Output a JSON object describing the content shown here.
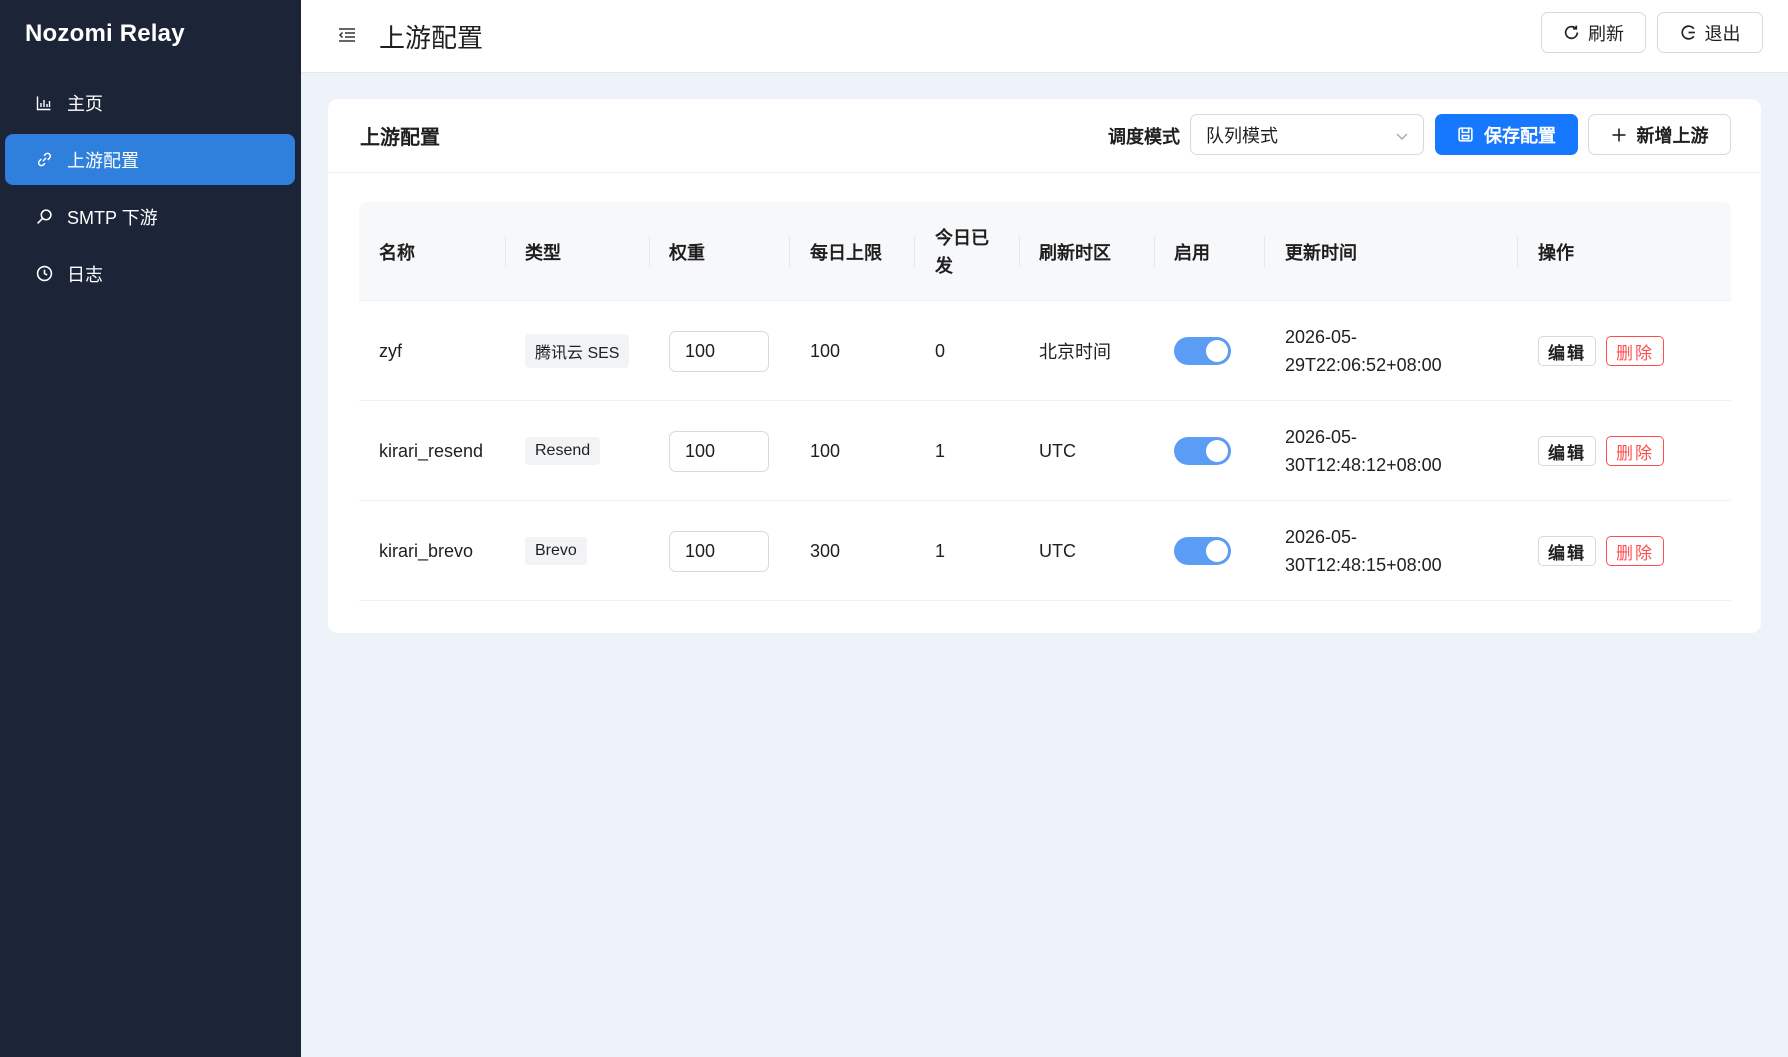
{
  "brand": "Nozomi Relay",
  "sidebar": {
    "items": [
      {
        "label": "主页",
        "icon": "bar-chart-icon",
        "active": false
      },
      {
        "label": "上游配置",
        "icon": "link-icon",
        "active": true
      },
      {
        "label": "SMTP 下游",
        "icon": "search-icon",
        "active": false
      },
      {
        "label": "日志",
        "icon": "clock-icon",
        "active": false
      }
    ]
  },
  "header": {
    "title": "上游配置",
    "refresh_label": "刷新",
    "logout_label": "退出"
  },
  "card": {
    "title": "上游配置",
    "mode_label": "调度模式",
    "mode_value": "队列模式",
    "save_label": "保存配置",
    "add_label": "新增上游"
  },
  "table": {
    "columns": [
      "名称",
      "类型",
      "权重",
      "每日上限",
      "今日已发",
      "刷新时区",
      "启用",
      "更新时间",
      "操作"
    ],
    "rows": [
      {
        "name": "zyf",
        "type": "腾讯云 SES",
        "weight": "100",
        "daily_limit": "100",
        "sent_today": "0",
        "timezone": "北京时间",
        "enabled": true,
        "updated_line1": "2026-05-",
        "updated_line2": "29T22:06:52+08:00"
      },
      {
        "name": "kirari_resend",
        "type": "Resend",
        "weight": "100",
        "daily_limit": "100",
        "sent_today": "1",
        "timezone": "UTC",
        "enabled": true,
        "updated_line1": "2026-05-",
        "updated_line2": "30T12:48:12+08:00"
      },
      {
        "name": "kirari_brevo",
        "type": "Brevo",
        "weight": "100",
        "daily_limit": "300",
        "sent_today": "1",
        "timezone": "UTC",
        "enabled": true,
        "updated_line1": "2026-05-",
        "updated_line2": "30T12:48:15+08:00"
      }
    ],
    "edit_label": "编辑",
    "delete_label": "删除"
  },
  "colors": {
    "sidebar_bg": "#1b2537",
    "active_nav": "#2f7fdc",
    "primary": "#1677ff",
    "danger": "#ff4d4f",
    "switch_on": "#5b9cf5",
    "page_bg": "#eef2f9"
  }
}
